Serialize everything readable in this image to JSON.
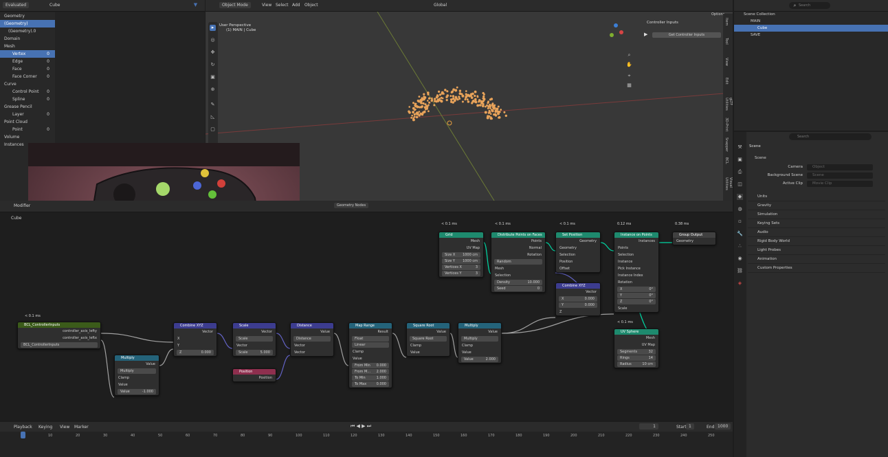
{
  "spreadsheet": {
    "eval_label": "Evaluated",
    "object": "Cube",
    "title": "Geometry",
    "rows": [
      {
        "label": "(Geometry)",
        "count": "",
        "sel": true,
        "indent": 0
      },
      {
        "label": "(Geometry).0",
        "count": "",
        "sel": false,
        "indent": 1
      },
      {
        "label": "Domain",
        "count": "",
        "sel": false,
        "indent": 0,
        "head": true
      },
      {
        "label": "Mesh",
        "count": "",
        "sel": false,
        "indent": 0
      },
      {
        "label": "Vertex",
        "count": "0",
        "sel": true,
        "indent": 2
      },
      {
        "label": "Edge",
        "count": "0",
        "sel": false,
        "indent": 2
      },
      {
        "label": "Face",
        "count": "0",
        "sel": false,
        "indent": 2
      },
      {
        "label": "Face Corner",
        "count": "0",
        "sel": false,
        "indent": 2
      },
      {
        "label": "Curve",
        "count": "",
        "sel": false,
        "indent": 0
      },
      {
        "label": "Control Point",
        "count": "0",
        "sel": false,
        "indent": 2
      },
      {
        "label": "Spline",
        "count": "0",
        "sel": false,
        "indent": 2
      },
      {
        "label": "Grease Pencil",
        "count": "",
        "sel": false,
        "indent": 0
      },
      {
        "label": "Layer",
        "count": "0",
        "sel": false,
        "indent": 2
      },
      {
        "label": "Point Cloud",
        "count": "",
        "sel": false,
        "indent": 0
      },
      {
        "label": "Point",
        "count": "0",
        "sel": false,
        "indent": 2
      },
      {
        "label": "Volume",
        "count": "",
        "sel": false,
        "indent": 0
      },
      {
        "label": "Instances",
        "count": "",
        "sel": false,
        "indent": 0
      }
    ]
  },
  "viewport": {
    "mode": "Object Mode",
    "menus": [
      "View",
      "Select",
      "Add",
      "Object"
    ],
    "orientation": "Global",
    "perspective": "User Perspective",
    "collection_line": "(1) MAIN | Cube",
    "options": "Options",
    "panel_title": "Controller Inputs",
    "panel_button": "Get Controller Inputs",
    "side_tabs": [
      "Item",
      "Tool",
      "View",
      "Edit",
      "gLTF Utilities",
      "3D-Print",
      "Snapper",
      "BCL",
      "Visual Utilities"
    ]
  },
  "outliner": {
    "search_placeholder": "Search",
    "items": [
      {
        "label": "Scene Collection",
        "indent": 0
      },
      {
        "label": "MAIN",
        "indent": 1
      },
      {
        "label": "Cube",
        "indent": 2,
        "sel": true
      },
      {
        "label": "SAVE",
        "indent": 1
      }
    ]
  },
  "properties": {
    "search_placeholder": "Search",
    "header": "Scene",
    "section": "Scene",
    "fields": [
      {
        "label": "Camera",
        "value": "Object"
      },
      {
        "label": "Background Scene",
        "value": "Scene"
      },
      {
        "label": "Active Clip",
        "value": "Movie Clip"
      }
    ],
    "panels": [
      "Units",
      "Gravity",
      "Simulation",
      "Keying Sets",
      "Audio",
      "Rigid Body World",
      "Light Probes",
      "Animation",
      "Custom Properties"
    ]
  },
  "node_editor": {
    "modifier_label": "Modifier",
    "object": "Cube",
    "tree_name": "Geometry Nodes",
    "nodes": {
      "controller": {
        "time": "< 0.1 ms",
        "title": "BCL_ControllerInputs",
        "out1": "controller_axis_lefty",
        "out2": "controller_axis_leftx",
        "field": "BCL_ControllerInputs"
      },
      "multiply1": {
        "title": "Multiply",
        "value": "Value",
        "op": "Multiply",
        "clamp": "Clamp",
        "in": "Value",
        "num": "-1.000"
      },
      "combine1": {
        "title": "Combine XYZ",
        "out": "Vector",
        "x": "X",
        "y": "Y",
        "z": "Z",
        "zval": "0.000"
      },
      "scale": {
        "title": "Scale",
        "out": "Vector",
        "op": "Scale",
        "in": "Vector",
        "s": "Scale",
        "sval": "5.000"
      },
      "position": {
        "title": "Position",
        "out": "Position"
      },
      "distance": {
        "title": "Distance",
        "out": "Value",
        "op": "Distance",
        "a": "Vector",
        "b": "Vector"
      },
      "maprange": {
        "title": "Map Range",
        "out": "Result",
        "type": "Float",
        "interp": "Linear",
        "clamp": "Clamp",
        "in": "Value",
        "rows": [
          [
            "From Min",
            "0.000"
          ],
          [
            "From M...",
            "2.000"
          ],
          [
            "To Min",
            "1.000"
          ],
          [
            "To Max",
            "0.000"
          ]
        ]
      },
      "sqrt": {
        "title": "Square Root",
        "out": "Value",
        "op": "Square Root",
        "clamp": "Clamp",
        "in": "Value"
      },
      "multiply2": {
        "title": "Multiply",
        "out": "Value",
        "op": "Multiply",
        "clamp": "Clamp",
        "in": "Value",
        "v": "Value",
        "vval": "2.000"
      },
      "grid": {
        "time": "< 0.1 ms",
        "title": "Grid",
        "out": "Mesh",
        "uv": "UV Map",
        "rows": [
          [
            "Size X",
            "1000 cm"
          ],
          [
            "Size Y",
            "1000 cm"
          ],
          [
            "Vertices X",
            "3"
          ],
          [
            "Vertices Y",
            "3"
          ]
        ]
      },
      "distribute": {
        "time": "< 0.1 ms",
        "title": "Distribute Points on Faces",
        "o1": "Points",
        "o2": "Normal",
        "o3": "Rotation",
        "mode": "Random",
        "i1": "Mesh",
        "i2": "Selection",
        "rows": [
          [
            "Density",
            "10.000"
          ],
          [
            "Seed",
            "0"
          ]
        ]
      },
      "setpos": {
        "time": "< 0.1 ms",
        "title": "Set Position",
        "out": "Geometry",
        "rows": [
          "Geometry",
          "Selection",
          "Position",
          "Offset"
        ]
      },
      "combine2": {
        "title": "Combine XYZ",
        "out": "Vector",
        "rows": [
          [
            "X",
            "0.000"
          ],
          [
            "Y",
            "0.000"
          ]
        ],
        "z": "Z"
      },
      "instance": {
        "time": "0.12 ms",
        "title": "Instance on Points",
        "out": "Instances",
        "rows": [
          "Points",
          "Selection",
          "Instance",
          "Pick Instance",
          "Instance Index",
          "Rotation"
        ],
        "rot": [
          [
            "X",
            "0°"
          ],
          [
            "Y",
            "0°"
          ],
          [
            "Z",
            "0°"
          ]
        ],
        "scale": "Scale"
      },
      "output": {
        "time": "0.38 ms",
        "title": "Group Output",
        "in": "Geometry"
      },
      "uvsphere": {
        "time": "< 0.1 ms",
        "title": "UV Sphere",
        "o1": "Mesh",
        "o2": "UV Map",
        "rows": [
          [
            "Segments",
            "32"
          ],
          [
            "Rings",
            "14"
          ],
          [
            "Radius",
            "10 cm"
          ]
        ]
      }
    }
  },
  "timeline": {
    "menus": [
      "Playback",
      "Keying",
      "View",
      "Marker"
    ],
    "frame": "1",
    "start_label": "Start",
    "start": "1",
    "end_label": "End",
    "end": "1000",
    "ticks": [
      "1",
      "10",
      "20",
      "30",
      "40",
      "50",
      "60",
      "70",
      "80",
      "90",
      "100",
      "110",
      "120",
      "130",
      "140",
      "150",
      "160",
      "170",
      "180",
      "190",
      "200",
      "210",
      "220",
      "230",
      "240",
      "250"
    ]
  },
  "colors": {
    "accent": "#4772b3",
    "geometry": "#00d6a3",
    "vector": "#6363c7",
    "float": "#a1a1a1",
    "header_geo": "#1e8a6e",
    "header_vec": "#3c3c8f",
    "header_util": "#24637a",
    "header_input": "#8e2f4e",
    "header_group": "#3b5b1a",
    "header_output": "#404040"
  }
}
